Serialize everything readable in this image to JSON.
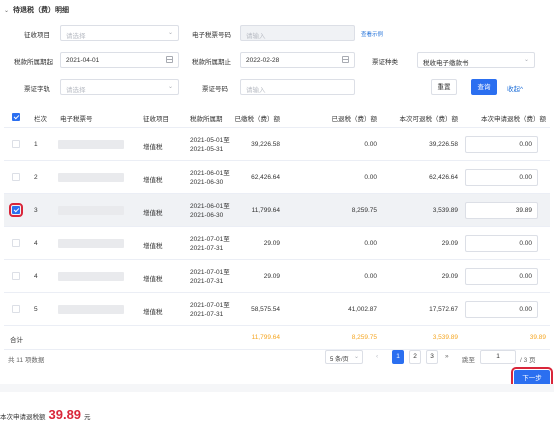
{
  "section_title": "待退税（费）明细",
  "form": {
    "levy_item": {
      "label": "征收项目",
      "placeholder": "请选择"
    },
    "tax_voucher_no": {
      "label": "电子税票号码",
      "placeholder": "请输入",
      "example_link": "查看示例"
    },
    "period_start": {
      "label": "税款所属期起",
      "value": "2021-04-01"
    },
    "period_end": {
      "label": "税款所属期止",
      "value": "2022-02-28"
    },
    "voucher_type": {
      "label": "票证种类",
      "value": "税收电子缴款书"
    },
    "voucher_word": {
      "label": "票证字轨",
      "placeholder": "请选择"
    },
    "voucher_no": {
      "label": "票证号码",
      "placeholder": "请输入"
    },
    "reset_label": "重置",
    "query_label": "查询",
    "collapse_label": "收起^"
  },
  "table": {
    "columns": [
      "栏次",
      "电子税票号",
      "征收项目",
      "税款所属期",
      "已缴税（费）额",
      "已退税（费）额",
      "本次可退税（费）额",
      "本次申请退税（费）额"
    ],
    "rows": [
      {
        "no": "1",
        "item": "增值税",
        "period_start": "2021-05-01至",
        "period_end": "2021-05-31",
        "paid": "39,226.58",
        "refunded": "0.00",
        "refundable": "39,226.58",
        "apply": "0.00",
        "checked": false
      },
      {
        "no": "2",
        "item": "增值税",
        "period_start": "2021-06-01至",
        "period_end": "2021-06-30",
        "paid": "62,426.64",
        "refunded": "0.00",
        "refundable": "62,426.64",
        "apply": "0.00",
        "checked": false
      },
      {
        "no": "3",
        "item": "增值税",
        "period_start": "2021-06-01至",
        "period_end": "2021-06-30",
        "paid": "11,799.64",
        "refunded": "8,259.75",
        "refundable": "3,539.89",
        "apply": "39.89",
        "checked": true
      },
      {
        "no": "4",
        "item": "增值税",
        "period_start": "2021-07-01至",
        "period_end": "2021-07-31",
        "paid": "29.09",
        "refunded": "0.00",
        "refundable": "29.09",
        "apply": "0.00",
        "checked": false
      },
      {
        "no": "4",
        "item": "增值税",
        "period_start": "2021-07-01至",
        "period_end": "2021-07-31",
        "paid": "29.09",
        "refunded": "0.00",
        "refundable": "29.09",
        "apply": "0.00",
        "checked": false
      },
      {
        "no": "5",
        "item": "增值税",
        "period_start": "2021-07-01至",
        "period_end": "2021-07-31",
        "paid": "58,575.54",
        "refunded": "41,002.87",
        "refundable": "17,572.67",
        "apply": "0.00",
        "checked": false
      }
    ],
    "total": {
      "label": "合计",
      "paid": "11,799.64",
      "refunded": "8,259.75",
      "refundable": "3,539.89",
      "apply": "39.89"
    }
  },
  "pagination": {
    "total_text": "共 11 项数据",
    "page_size": "5 条/页",
    "prev": "‹",
    "pages": [
      "1",
      "2",
      "3"
    ],
    "more": "»",
    "jump_label": "跳至",
    "jump_value": "1",
    "jump_total": "/ 3 页"
  },
  "footer": {
    "prefix": "本次申请退税额",
    "amount": "39.89",
    "unit": "元",
    "next_label": "下一步"
  },
  "colors": {
    "primary": "#2b6ff0",
    "accent_red": "#d9263a",
    "total_orange": "#f5a623"
  }
}
